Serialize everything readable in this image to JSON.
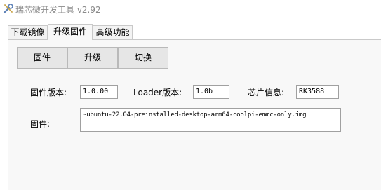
{
  "window": {
    "title": "瑞芯微开发工具 v2.92",
    "icon": "wrench-tools-icon"
  },
  "tabs": [
    {
      "label": "下载镜像",
      "active": false
    },
    {
      "label": "升级固件",
      "active": true
    },
    {
      "label": "高级功能",
      "active": false
    }
  ],
  "toolbar": {
    "firmware_label": "固件",
    "upgrade_label": "升级",
    "switch_label": "切换"
  },
  "info": {
    "firmware_version_label": "固件版本:",
    "firmware_version_value": "1.0.00",
    "loader_version_label": "Loader版本:",
    "loader_version_value": "1.0b",
    "chip_info_label": "芯片信息:",
    "chip_info_value": "RK3588",
    "firmware_path_label": "固件:",
    "firmware_path_value": "~ubuntu-22.04-preinstalled-desktop-arm64-coolpi-emmc-only.img"
  }
}
